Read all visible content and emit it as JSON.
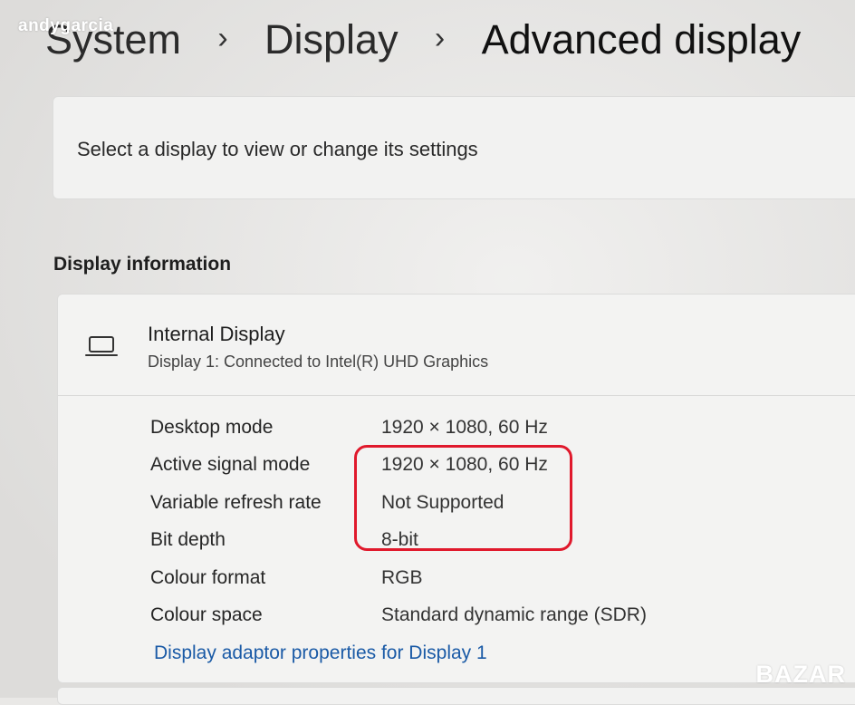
{
  "watermark": "andygarcia",
  "breadcrumb": {
    "items": [
      "System",
      "Display",
      "Advanced display"
    ],
    "separator": "›"
  },
  "select_card": {
    "text": "Select a display to view or change its settings"
  },
  "display_info": {
    "section_title": "Display information",
    "display_name": "Internal Display",
    "display_subtitle": "Display 1: Connected to Intel(R) UHD Graphics",
    "icon": "laptop-icon",
    "properties": [
      {
        "label": "Desktop mode",
        "value": "1920 × 1080, 60 Hz"
      },
      {
        "label": "Active signal mode",
        "value": "1920 × 1080, 60 Hz"
      },
      {
        "label": "Variable refresh rate",
        "value": "Not Supported"
      },
      {
        "label": "Bit depth",
        "value": "8-bit"
      },
      {
        "label": "Colour format",
        "value": "RGB"
      },
      {
        "label": "Colour space",
        "value": "Standard dynamic range (SDR)"
      }
    ],
    "adapter_link": "Display adaptor properties for Display 1"
  },
  "logo": "BAZAR",
  "colors": {
    "link": "#1a5aa6",
    "highlight": "#e0192c"
  }
}
